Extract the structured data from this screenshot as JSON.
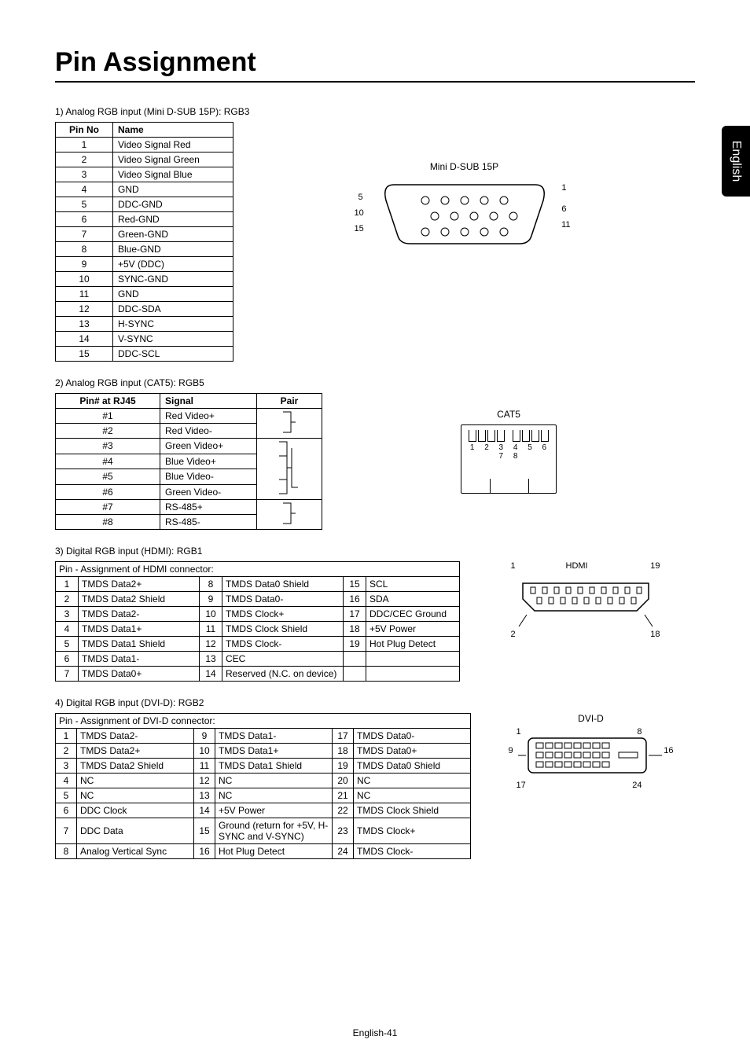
{
  "sideTab": "English",
  "title": "Pin Assignment",
  "footer": "English-41",
  "section1": {
    "label": "1)   Analog RGB input (Mini D-SUB 15P): RGB3",
    "head": {
      "c1": "Pin No",
      "c2": "Name"
    },
    "rows": [
      {
        "n": "1",
        "name": "Video Signal Red"
      },
      {
        "n": "2",
        "name": "Video Signal Green"
      },
      {
        "n": "3",
        "name": "Video Signal Blue"
      },
      {
        "n": "4",
        "name": "GND"
      },
      {
        "n": "5",
        "name": "DDC-GND"
      },
      {
        "n": "6",
        "name": "Red-GND"
      },
      {
        "n": "7",
        "name": "Green-GND"
      },
      {
        "n": "8",
        "name": "Blue-GND"
      },
      {
        "n": "9",
        "name": "+5V (DDC)"
      },
      {
        "n": "10",
        "name": "SYNC-GND"
      },
      {
        "n": "11",
        "name": "GND"
      },
      {
        "n": "12",
        "name": "DDC-SDA"
      },
      {
        "n": "13",
        "name": "H-SYNC"
      },
      {
        "n": "14",
        "name": "V-SYNC"
      },
      {
        "n": "15",
        "name": "DDC-SCL"
      }
    ],
    "diagramLabel": "Mini D-SUB 15P",
    "diagramPins": {
      "l5": "5",
      "l10": "10",
      "l15": "15",
      "r1": "1",
      "r6": "6",
      "r11": "11"
    }
  },
  "section2": {
    "label": "2)   Analog RGB input (CAT5): RGB5",
    "head": {
      "c1": "Pin# at RJ45",
      "c2": "Signal",
      "c3": "Pair"
    },
    "rows": [
      {
        "n": "#1",
        "sig": "Red Video+"
      },
      {
        "n": "#2",
        "sig": "Red Video-"
      },
      {
        "n": "#3",
        "sig": "Green Video+"
      },
      {
        "n": "#4",
        "sig": "Blue Video+"
      },
      {
        "n": "#5",
        "sig": "Blue Video-"
      },
      {
        "n": "#6",
        "sig": "Green Video-"
      },
      {
        "n": "#7",
        "sig": "RS-485+"
      },
      {
        "n": "#8",
        "sig": "RS-485-"
      }
    ],
    "diagramLabel": "CAT5",
    "diagramNums": "1 2 3 4  5 6 7 8"
  },
  "section3": {
    "label": "3)   Digital RGB input (HDMI): RGB1",
    "header": "Pin - Assignment of HDMI connector:",
    "rows": [
      {
        "a": "1",
        "an": "TMDS Data2+",
        "b": "8",
        "bn": "TMDS Data0 Shield",
        "c": "15",
        "cn": "SCL"
      },
      {
        "a": "2",
        "an": "TMDS Data2 Shield",
        "b": "9",
        "bn": "TMDS Data0-",
        "c": "16",
        "cn": "SDA"
      },
      {
        "a": "3",
        "an": "TMDS Data2-",
        "b": "10",
        "bn": "TMDS Clock+",
        "c": "17",
        "cn": "DDC/CEC Ground"
      },
      {
        "a": "4",
        "an": "TMDS Data1+",
        "b": "11",
        "bn": "TMDS Clock Shield",
        "c": "18",
        "cn": "+5V Power"
      },
      {
        "a": "5",
        "an": "TMDS Data1 Shield",
        "b": "12",
        "bn": "TMDS Clock-",
        "c": "19",
        "cn": "Hot Plug Detect"
      },
      {
        "a": "6",
        "an": "TMDS Data1-",
        "b": "13",
        "bn": "CEC",
        "c": "",
        "cn": ""
      },
      {
        "a": "7",
        "an": "TMDS Data0+",
        "b": "14",
        "bn": "Reserved (N.C. on device)",
        "c": "",
        "cn": ""
      }
    ],
    "diagramLabel": "HDMI",
    "diagramPins": {
      "tl": "1",
      "tr": "19",
      "bl": "2",
      "br": "18"
    }
  },
  "section4": {
    "label": "4)   Digital RGB input (DVI-D): RGB2",
    "header": "Pin - Assignment of DVI-D connector:",
    "rows": [
      {
        "a": "1",
        "an": "TMDS Data2-",
        "b": "9",
        "bn": "TMDS Data1-",
        "c": "17",
        "cn": "TMDS Data0-"
      },
      {
        "a": "2",
        "an": "TMDS Data2+",
        "b": "10",
        "bn": "TMDS Data1+",
        "c": "18",
        "cn": "TMDS Data0+"
      },
      {
        "a": "3",
        "an": "TMDS Data2 Shield",
        "b": "11",
        "bn": "TMDS Data1 Shield",
        "c": "19",
        "cn": "TMDS Data0 Shield"
      },
      {
        "a": "4",
        "an": "NC",
        "b": "12",
        "bn": "NC",
        "c": "20",
        "cn": "NC"
      },
      {
        "a": "5",
        "an": "NC",
        "b": "13",
        "bn": "NC",
        "c": "21",
        "cn": "NC"
      },
      {
        "a": "6",
        "an": "DDC Clock",
        "b": "14",
        "bn": "+5V Power",
        "c": "22",
        "cn": "TMDS Clock Shield"
      },
      {
        "a": "7",
        "an": "DDC Data",
        "b": "15",
        "bn": "Ground (return for +5V, H-SYNC and V-SYNC)",
        "c": "23",
        "cn": "TMDS Clock+"
      },
      {
        "a": "8",
        "an": "Analog Vertical Sync",
        "b": "16",
        "bn": "Hot Plug Detect",
        "c": "24",
        "cn": "TMDS Clock-"
      }
    ],
    "diagramLabel": "DVI-D",
    "diagramPins": {
      "tl": "1",
      "tr": "8",
      "ml": "9",
      "mr": "16",
      "bl": "17",
      "br": "24"
    }
  }
}
